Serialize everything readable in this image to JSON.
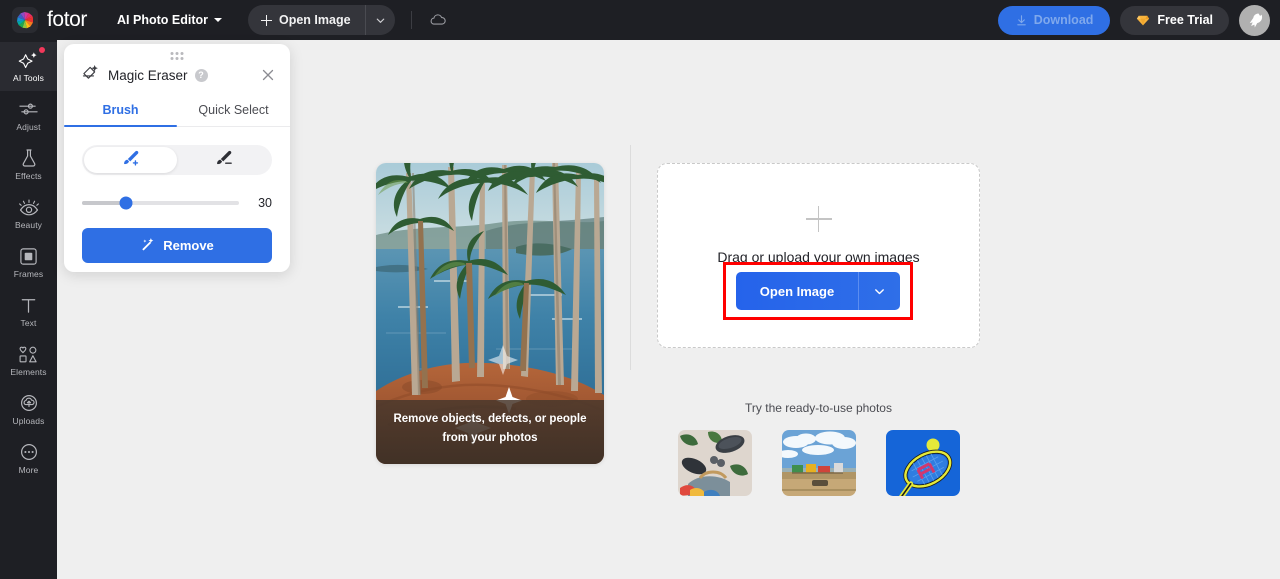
{
  "header": {
    "brand": "fotor",
    "brand_icon": "fotor-pinwheel-logo-icon",
    "product_menu": "AI Photo Editor",
    "open_image": "Open Image",
    "open_image_plus_icon": "plus-icon",
    "open_image_caret_icon": "chevron-down-icon",
    "cloud_icon": "cloud-icon",
    "download": "Download",
    "download_icon": "download-arrow-icon",
    "free_trial": "Free Trial",
    "free_trial_icon": "diamond-gem-icon",
    "avatar_icon": "bird-avatar-icon",
    "accent_blue": "#2f6fe4",
    "header_bg": "#1e1f24"
  },
  "sidebar": {
    "items": [
      {
        "label": "AI Tools",
        "icon": "ai-sparkle-icon",
        "active": true,
        "badge": true
      },
      {
        "label": "Adjust",
        "icon": "sliders-icon",
        "active": false,
        "badge": false
      },
      {
        "label": "Effects",
        "icon": "flask-icon",
        "active": false,
        "badge": false
      },
      {
        "label": "Beauty",
        "icon": "eye-icon",
        "active": false,
        "badge": false
      },
      {
        "label": "Frames",
        "icon": "frame-square-icon",
        "active": false,
        "badge": false
      },
      {
        "label": "Text",
        "icon": "text-t-icon",
        "active": false,
        "badge": false
      },
      {
        "label": "Elements",
        "icon": "shapes-icon",
        "active": false,
        "badge": false
      },
      {
        "label": "Uploads",
        "icon": "upload-cloud-icon",
        "active": false,
        "badge": false
      },
      {
        "label": "More",
        "icon": "ellipsis-circle-icon",
        "active": false,
        "badge": false
      }
    ]
  },
  "panel": {
    "title": "Magic Eraser",
    "title_icon": "magic-eraser-icon",
    "help_icon": "question-mark-icon",
    "help_glyph": "?",
    "close_icon": "close-icon",
    "grip_icon": "drag-grip-icon",
    "tabs": [
      {
        "label": "Brush",
        "active": true
      },
      {
        "label": "Quick Select",
        "active": false
      }
    ],
    "tools": [
      {
        "icon": "brush-add-icon",
        "active": true
      },
      {
        "icon": "brush-erase-icon",
        "active": false
      }
    ],
    "brush_size": "30",
    "brush_size_percent": 28,
    "remove_label": "Remove",
    "remove_icon": "magic-wand-icon"
  },
  "canvas": {
    "preview": {
      "caption_line1": "Remove objects, defects, or people",
      "caption_line2": "from your photos",
      "alt": "tropical-beach-palm-trees-photo"
    },
    "dropzone": {
      "plus_icon": "plus-icon",
      "text": "Drag or upload your own images",
      "open_image": "Open Image",
      "caret_icon": "chevron-down-icon",
      "highlight_color": "#ff0000"
    },
    "ready_title": "Try the ready-to-use photos",
    "thumbnails": [
      {
        "name": "flatlay-accessories-thumbnail"
      },
      {
        "name": "desert-road-sign-thumbnail"
      },
      {
        "name": "tennis-racket-ball-thumbnail"
      }
    ]
  }
}
